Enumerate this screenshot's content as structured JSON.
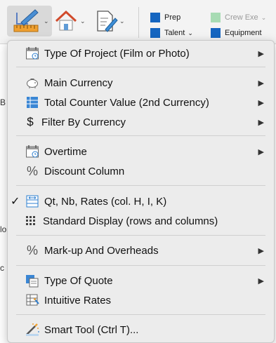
{
  "ribbon": {
    "legend": [
      {
        "label": "Prep",
        "color": "#1565c0",
        "muted": false,
        "caret": false
      },
      {
        "label": "Crew Exe",
        "color": "#a7dbb3",
        "muted": true,
        "caret": true
      },
      {
        "label": "Talent",
        "color": "#1565c0",
        "muted": false,
        "caret": true
      },
      {
        "label": "Equipment",
        "color": "#1565c0",
        "muted": false,
        "caret": false
      }
    ]
  },
  "fragments": [
    "B",
    "lo",
    "c"
  ],
  "menu": {
    "items": [
      {
        "label": "Type Of Project (Film or Photo)",
        "icon": "calendar-icon",
        "submenu": true
      },
      {
        "label": "Main Currency",
        "icon": "piggy-bank-icon",
        "submenu": true
      },
      {
        "label": "Total Counter Value (2nd Currency)",
        "icon": "table-blue-icon",
        "submenu": true
      },
      {
        "label": "Filter By Currency",
        "icon": "dollar-icon",
        "submenu": true
      },
      {
        "label": "Overtime",
        "icon": "calendar-clock-icon",
        "submenu": true
      },
      {
        "label": "Discount Column",
        "icon": "percent-icon",
        "submenu": false
      },
      {
        "label": "Qt, Nb, Rates (col. H, I, K)",
        "icon": "columns-arrows-icon",
        "submenu": false,
        "checked": true
      },
      {
        "label": "Standard Display (rows and columns)",
        "icon": "grid-icon",
        "submenu": false
      },
      {
        "label": "Mark-up And Overheads",
        "icon": "percent-icon",
        "submenu": true
      },
      {
        "label": "Type Of Quote",
        "icon": "quote-doc-icon",
        "submenu": true
      },
      {
        "label": "Intuitive Rates",
        "icon": "sparkle-table-icon",
        "submenu": false
      },
      {
        "label": "Smart Tool (Ctrl T)...",
        "icon": "magic-wand-icon",
        "submenu": false
      }
    ],
    "check_glyph": "✓",
    "arrow_glyph": "▶"
  }
}
